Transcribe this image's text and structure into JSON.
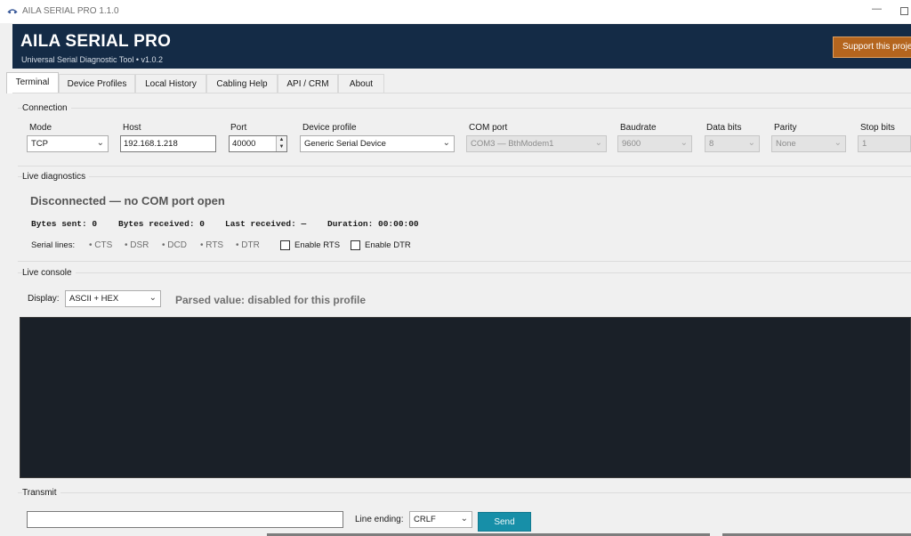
{
  "window": {
    "title": "AILA SERIAL PRO 1.1.0",
    "minimize_glyph": "—"
  },
  "header": {
    "brand": "AILA SERIAL PRO",
    "subtitle": "Universal Serial Diagnostic Tool  •  v1.0.2",
    "support_label": "Support this project",
    "bg_color": "#142b46",
    "support_color": "#b4651e"
  },
  "tabs": [
    {
      "label": "Terminal",
      "active": true
    },
    {
      "label": "Device Profiles",
      "active": false
    },
    {
      "label": "Local History",
      "active": false
    },
    {
      "label": "Cabling Help",
      "active": false
    },
    {
      "label": "API / CRM",
      "active": false
    },
    {
      "label": "About",
      "active": false
    }
  ],
  "connection": {
    "group_label": "Connection",
    "mode": {
      "label": "Mode",
      "value": "TCP"
    },
    "host": {
      "label": "Host",
      "value": "192.168.1.218"
    },
    "port": {
      "label": "Port",
      "value": "40000"
    },
    "device_profile": {
      "label": "Device profile",
      "value": "Generic Serial Device"
    },
    "com_port": {
      "label": "COM port",
      "value": "COM3 — BthModem1"
    },
    "baudrate": {
      "label": "Baudrate",
      "value": "9600"
    },
    "data_bits": {
      "label": "Data bits",
      "value": "8"
    },
    "parity": {
      "label": "Parity",
      "value": "None"
    },
    "stop_bits": {
      "label": "Stop bits",
      "value": "1"
    }
  },
  "diagnostics": {
    "group_label": "Live diagnostics",
    "status": "Disconnected — no COM port open",
    "bytes_sent": "Bytes sent: 0",
    "bytes_received": "Bytes received: 0",
    "last_received": "Last received: —",
    "duration": "Duration: 00:00:00",
    "serial_lines_label": "Serial lines:",
    "lines": [
      "• CTS",
      "• DSR",
      "• DCD",
      "• RTS",
      "• DTR"
    ],
    "enable_rts": "Enable RTS",
    "enable_dtr": "Enable DTR"
  },
  "console": {
    "group_label": "Live console",
    "display_label": "Display:",
    "display_value": "ASCII + HEX",
    "parsed_value": "Parsed value: disabled for this profile",
    "bg_color": "#1a2028"
  },
  "transmit": {
    "group_label": "Transmit",
    "input_value": "",
    "line_ending_label": "Line ending:",
    "line_ending_value": "CRLF",
    "send_label": "Send",
    "send_color": "#178fa8"
  },
  "icons": {
    "dropdown": "chevron-down-icon",
    "spin_up": "▲",
    "spin_down": "▼"
  }
}
